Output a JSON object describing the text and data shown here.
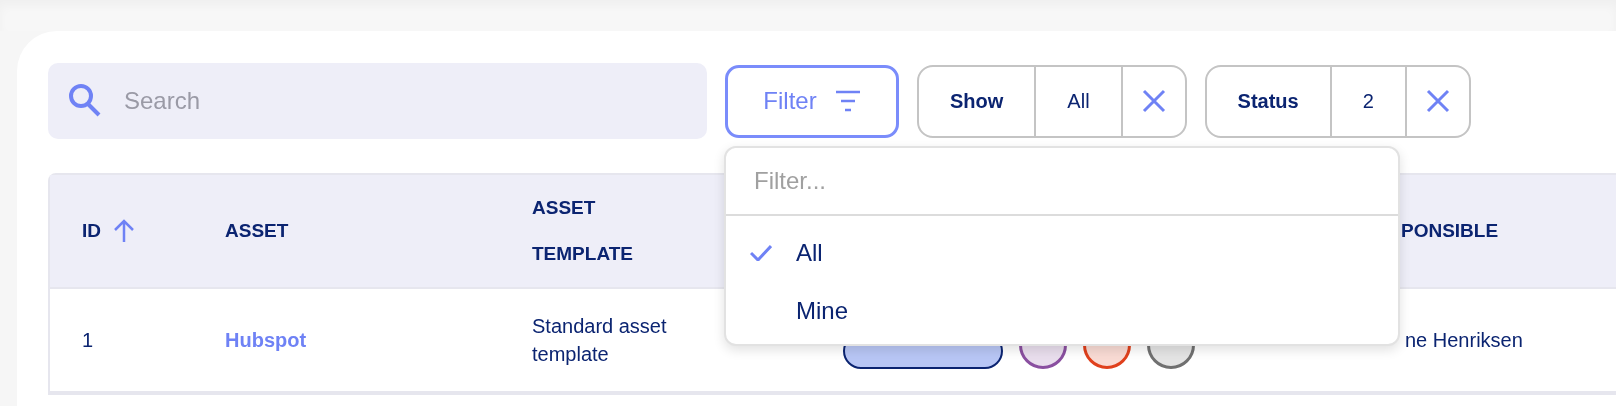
{
  "search": {
    "placeholder": "Search"
  },
  "filter_button": {
    "label": "Filter",
    "selected": true
  },
  "chips": [
    {
      "name": "Show",
      "value": "All"
    },
    {
      "name": "Status",
      "value": "2"
    }
  ],
  "table": {
    "columns": [
      {
        "label": "ID",
        "sorted": true
      },
      {
        "label": "ASSET",
        "sorted": false
      },
      {
        "label": "ASSET TEMPLATE",
        "sorted": false
      },
      {},
      {
        "label": "PONSIBLE",
        "sorted": false
      }
    ],
    "rows": [
      {
        "id": "1",
        "asset": "Hubspot",
        "template": "Standard asset template",
        "tags": [
          {
            "kind": "pill",
            "color": "#b8c6f5"
          },
          {
            "kind": "dot",
            "color": "#8a4fa0"
          },
          {
            "kind": "dot",
            "color": "#e0401c"
          },
          {
            "kind": "dot",
            "color": "#707070"
          }
        ],
        "responsible": "ne Henriksen"
      }
    ]
  },
  "dropdown": {
    "placeholder": "Filter...",
    "options": [
      {
        "label": "All",
        "selected": true
      },
      {
        "label": "Mine",
        "selected": false
      }
    ]
  }
}
